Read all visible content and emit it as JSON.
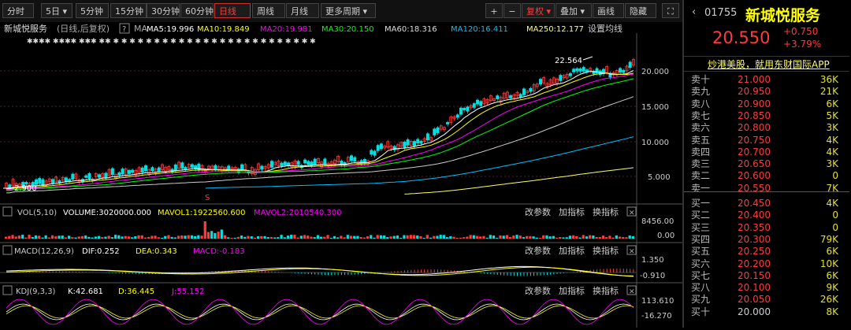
{
  "toolbar": {
    "tabs": [
      "分时",
      "5日 ▾",
      "5分钟",
      "15分钟",
      "30分钟",
      "60分钟",
      "日线",
      "周线",
      "月线",
      "更多周期 ▾"
    ],
    "right_tools": [
      "+",
      "−",
      "复权 ▾",
      "叠加 ▾",
      "画线",
      "隐藏"
    ]
  },
  "chart_header": {
    "name": "新城悦服务",
    "mode": "(日线,后复权)",
    "help": "?",
    "ma_label": "MA",
    "ma": [
      {
        "label": "MA5:19.996",
        "color": "#ffffff"
      },
      {
        "label": "MA10:19.849",
        "color": "#ffff00"
      },
      {
        "label": "MA20:19.981",
        "color": "#ff00ff"
      },
      {
        "label": "MA30:20.150",
        "color": "#00ff00"
      },
      {
        "label": "MA60:18.316",
        "color": "#dddddd"
      },
      {
        "label": "MA120:16.411",
        "color": "#00bfff"
      },
      {
        "label": "MA250:12.177",
        "color": "#ffff66"
      }
    ],
    "settings": "设置均线"
  },
  "price_axis": [
    "20.000",
    "15.000",
    "10.000",
    "5.000"
  ],
  "annotations": {
    "high": "22.564",
    "low": "2.900",
    "marker": "S"
  },
  "vol": {
    "label": "VOL(5,10)",
    "volume": "VOLUME:3020000.000",
    "mavol1": "MAVOL1:1922560.600",
    "mavol2": "MAVOL2:2010540.300",
    "axis": [
      "8456.00",
      "0.00"
    ]
  },
  "macd": {
    "label": "MACD(12,26,9)",
    "dif": "DIF:0.252",
    "dea": "DEA:0.343",
    "macd": "MACD:-0.183",
    "axis": [
      "1.350",
      "-0.910"
    ]
  },
  "kdj": {
    "label": "KDJ(9,3,3)",
    "k": "K:42.681",
    "d": "D:36.445",
    "j": "J:55.152",
    "axis": [
      "113.610",
      "-16.270"
    ]
  },
  "indicator_buttons": [
    "改参数",
    "加指标",
    "换指标"
  ],
  "stock": {
    "code": "01755",
    "name": "新城悦服务",
    "price": "20.550",
    "change": "+0.750",
    "change_pct": "+3.79%",
    "ad": "炒港美股，就用东财国际APP"
  },
  "order_book": {
    "asks": [
      {
        "label": "卖十",
        "price": "21.000",
        "vol": "36K",
        "dir": "up"
      },
      {
        "label": "卖九",
        "price": "20.950",
        "vol": "21K",
        "dir": "up"
      },
      {
        "label": "卖八",
        "price": "20.900",
        "vol": "6K",
        "dir": "up"
      },
      {
        "label": "卖七",
        "price": "20.850",
        "vol": "5K",
        "dir": "up"
      },
      {
        "label": "卖六",
        "price": "20.800",
        "vol": "3K",
        "dir": "up"
      },
      {
        "label": "卖五",
        "price": "20.750",
        "vol": "4K",
        "dir": "up"
      },
      {
        "label": "卖四",
        "price": "20.700",
        "vol": "4K",
        "dir": "up"
      },
      {
        "label": "卖三",
        "price": "20.650",
        "vol": "3K",
        "dir": "up"
      },
      {
        "label": "卖二",
        "price": "20.600",
        "vol": "0",
        "dir": "up"
      },
      {
        "label": "卖一",
        "price": "20.550",
        "vol": "7K",
        "dir": "up"
      }
    ],
    "bids": [
      {
        "label": "买一",
        "price": "20.450",
        "vol": "4K",
        "dir": "up"
      },
      {
        "label": "买二",
        "price": "20.400",
        "vol": "0",
        "dir": "up"
      },
      {
        "label": "买三",
        "price": "20.350",
        "vol": "0",
        "dir": "up"
      },
      {
        "label": "买四",
        "price": "20.300",
        "vol": "79K",
        "dir": "up"
      },
      {
        "label": "买五",
        "price": "20.250",
        "vol": "6K",
        "dir": "up"
      },
      {
        "label": "买六",
        "price": "20.200",
        "vol": "10K",
        "dir": "up"
      },
      {
        "label": "买七",
        "price": "20.150",
        "vol": "6K",
        "dir": "up"
      },
      {
        "label": "买八",
        "price": "20.100",
        "vol": "9K",
        "dir": "up"
      },
      {
        "label": "买九",
        "price": "20.050",
        "vol": "26K",
        "dir": "up"
      },
      {
        "label": "买十",
        "price": "20.000",
        "vol": "8K",
        "dir": "down"
      }
    ]
  }
}
